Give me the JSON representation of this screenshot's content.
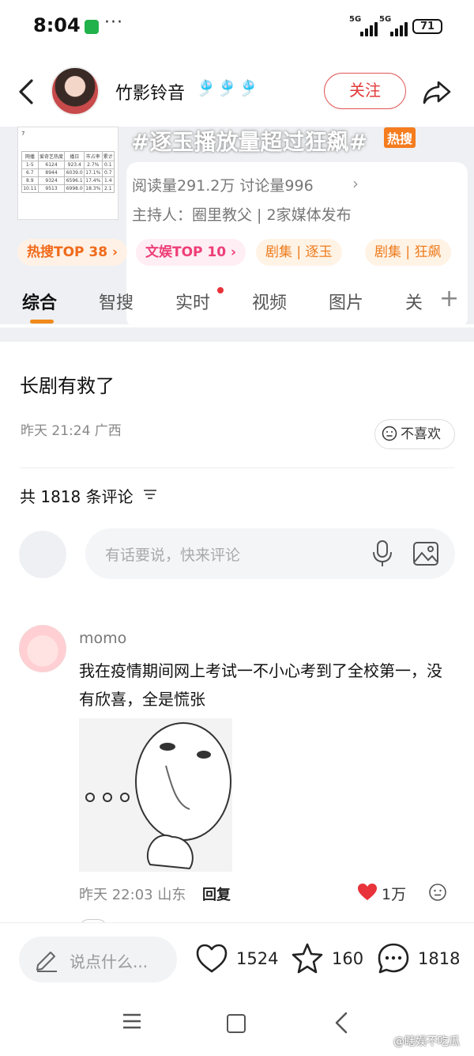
{
  "status": {
    "time": "8:04",
    "dots": "···",
    "signal1": "5G",
    "signal2": "5G",
    "battery": "71"
  },
  "header": {
    "username": "竹影铃音",
    "username_decoration": "🎐🎐🎐",
    "follow_label": "关注"
  },
  "topic": {
    "title": "#逐玉播放量超过狂飙#",
    "hot_badge": "热搜",
    "stats": "阅读量291.2万  讨论量996",
    "host": "主持人：圈里教父 | 2家媒体发布",
    "thumb_caption": "7",
    "thumb_header": [
      "网播",
      "爱奇艺热度",
      "云合",
      "播日",
      "市占率",
      "累计"
    ],
    "thumb_rows": [
      [
        "1-5",
        "6124",
        "923.4",
        "2.7%",
        "0.1"
      ],
      [
        "6.7",
        "8944",
        "6039.0",
        "17.1%",
        "0.7"
      ],
      [
        "8.9",
        "9324",
        "6596.1",
        "17.4%",
        "1.4"
      ],
      [
        "10.11",
        "9513",
        "6998.0",
        "18.3%",
        "2.1"
      ]
    ]
  },
  "tags": {
    "hot": "热搜TOP 38 ›",
    "ent": "文娱TOP 10 ›",
    "drama1": "剧集 | 逐玉",
    "drama2": "剧集 | 狂飙"
  },
  "tabs": [
    "综合",
    "智搜",
    "实时",
    "视频",
    "图片",
    "关"
  ],
  "post": {
    "title": "长剧有救了",
    "meta": "昨天 21:24 广西",
    "dislike_label": "不喜欢",
    "comment_count": "共 1818 条评论",
    "input_placeholder": "有话要说，快来评论"
  },
  "comment": {
    "name": "momo",
    "text": "我在疫情期间网上考试一不小心考到了全校第一，没有欣喜，全是慌张",
    "meta": "昨天 22:03 山东",
    "reply_label": "回复",
    "likes": "1万"
  },
  "bottom": {
    "say_placeholder": "说点什么...",
    "likes": "1524",
    "favorites": "160",
    "comments": "1818"
  },
  "watermark": "@瞎娱不吃瓜",
  "colors": {
    "accent_orange": "#f08a1c",
    "follow_red": "#e23a3a",
    "heart_red": "#e8333a"
  }
}
